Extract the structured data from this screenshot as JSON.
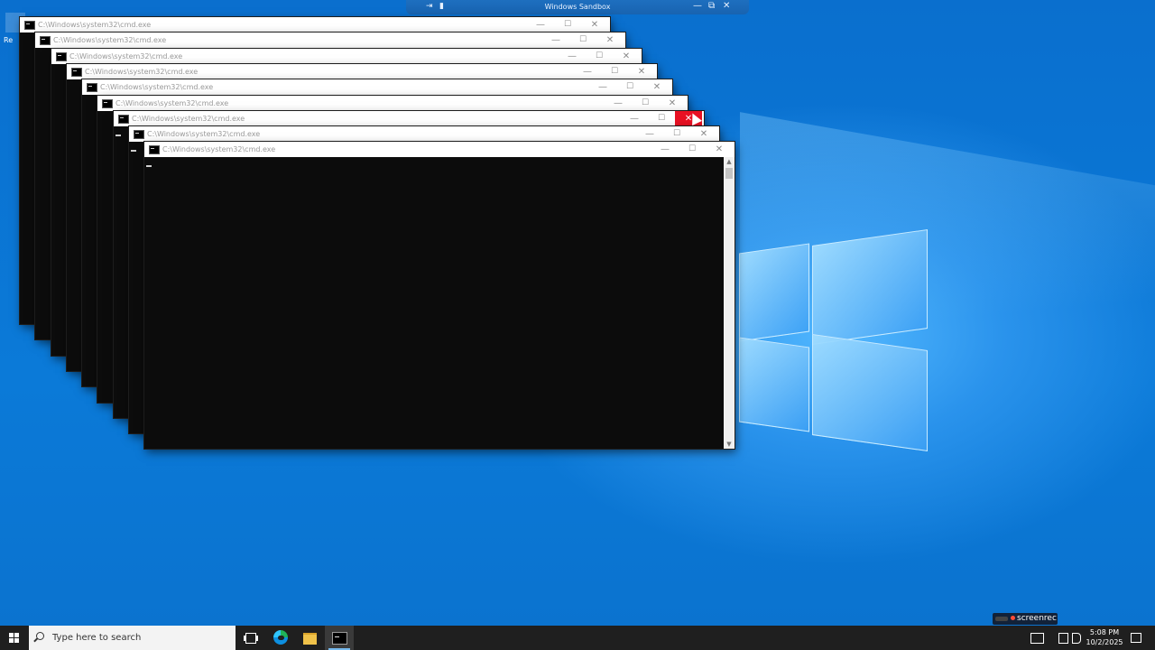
{
  "sandbox_bar": {
    "title": "Windows Sandbox",
    "pin_glyph": "⇥",
    "signal_glyph": "▮",
    "minimize_glyph": "—",
    "restore_glyph": "⧉",
    "close_glyph": "✕"
  },
  "desktop": {
    "icon_label": "Re"
  },
  "cmd_window": {
    "title": "C:\\Windows\\system32\\cmd.exe",
    "minimize_glyph": "—",
    "maximize_glyph": "☐",
    "close_glyph": "✕",
    "scroll_up_glyph": "▲",
    "scroll_down_glyph": "▼"
  },
  "watermark": {
    "label": "screenrec"
  },
  "taskbar": {
    "search_placeholder": "Type here to search",
    "clock_time": "5:08 PM",
    "clock_date": "10/2/2025"
  },
  "colors": {
    "close_hover": "#e81123",
    "desktop_blue": "#0a73d0",
    "taskbar": "#1f1f1f"
  }
}
